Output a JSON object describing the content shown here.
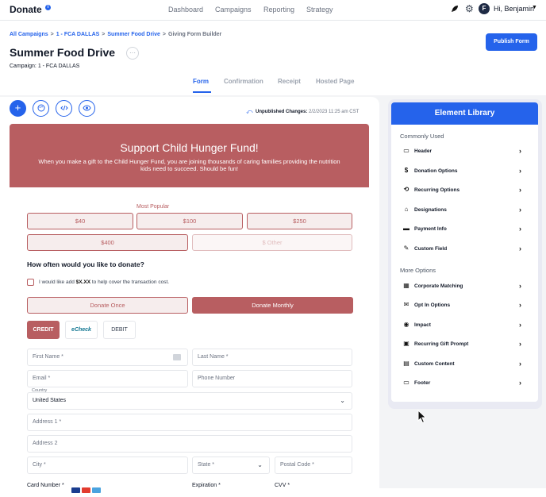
{
  "topbar": {
    "logo": "Donate",
    "info": "i",
    "nav": [
      "Dashboard",
      "Campaigns",
      "Reporting",
      "Strategy"
    ],
    "avatar_initial": "F",
    "greeting": "Hi, Benjamin",
    "caret": "▼"
  },
  "breadcrumb": {
    "items": [
      "All Campaigns",
      "1 - FCA DALLAS",
      "Summer Food Drive"
    ],
    "current": "Giving Form Builder",
    "separator": ">"
  },
  "header": {
    "title": "Summer Food Drive",
    "more": "···",
    "campaign_label": "Campaign:",
    "campaign_value": "1 - FCA DALLAS",
    "publish": "Publish Form"
  },
  "tabs": [
    "Form",
    "Confirmation",
    "Receipt",
    "Hosted Page"
  ],
  "toolbar": {
    "add": "+",
    "unpublished_label": "Unpublished Changes:",
    "unpublished_time": "2/2/2023 11:25 am CST"
  },
  "banner": {
    "title": "Support Child Hunger Fund!",
    "subtitle": "When you make a gift to the Child Hunger Fund, you are joining thousands of caring families providing the nutrition kids need to succeed. Should be fun!"
  },
  "amounts": {
    "most_popular": "Most Popular",
    "options": [
      "$40",
      "$100",
      "$250",
      "$400"
    ],
    "other_placeholder": "$ Other"
  },
  "frequency": {
    "question": "How often would you like to donate?",
    "cover_prefix": "I would like add ",
    "cover_amount": "$X.XX",
    "cover_suffix": " to help cover the transaction cost.",
    "once": "Donate Once",
    "monthly": "Donate Monthly"
  },
  "payment": {
    "credit": "CREDIT",
    "echeck": "eCheck",
    "debit": "DEBIT"
  },
  "fields": {
    "first_name": "First Name *",
    "last_name": "Last Name *",
    "email": "Email *",
    "phone": "Phone Number",
    "country_label": "Country",
    "country_value": "United States",
    "address1": "Address 1 *",
    "address2": "Address 2",
    "city": "City *",
    "state": "State *",
    "postal": "Postal Code *",
    "card_number": "Card Number *",
    "expiration": "Expiration *",
    "cvv": "CVV *"
  },
  "library": {
    "title": "Element Library",
    "common_heading": "Commonly Used",
    "common": [
      {
        "icon": "header-icon",
        "glyph": "▭",
        "label": "Header"
      },
      {
        "icon": "dollar-icon",
        "glyph": "$",
        "label": "Donation Options"
      },
      {
        "icon": "repeat-icon",
        "glyph": "⟲",
        "label": "Recurring Options"
      },
      {
        "icon": "building-icon",
        "glyph": "⌂",
        "label": "Designations"
      },
      {
        "icon": "card-icon",
        "glyph": "▬",
        "label": "Payment Info"
      },
      {
        "icon": "edit-icon",
        "glyph": "✎",
        "label": "Custom Field"
      }
    ],
    "more_heading": "More Options",
    "more": [
      {
        "icon": "corporate-icon",
        "glyph": "▦",
        "label": "Corporate Matching"
      },
      {
        "icon": "mail-icon",
        "glyph": "✉",
        "label": "Opt In Options"
      },
      {
        "icon": "pin-icon",
        "glyph": "◉",
        "label": "Impact"
      },
      {
        "icon": "calendar-icon",
        "glyph": "▣",
        "label": "Recurring Gift Prompt"
      },
      {
        "icon": "message-icon",
        "glyph": "▤",
        "label": "Custom Content"
      },
      {
        "icon": "footer-icon",
        "glyph": "▭",
        "label": "Footer"
      }
    ]
  },
  "colors": {
    "accent": "#2563eb",
    "brand": "#b85e61"
  }
}
